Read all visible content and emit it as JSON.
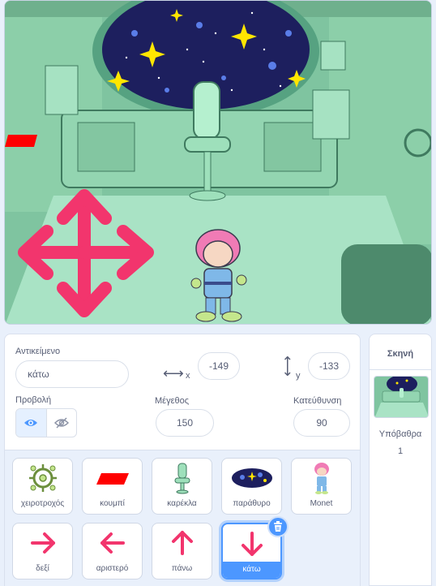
{
  "sprite_info": {
    "sprite_label": "Αντικείμενο",
    "sprite_name": "κάτω",
    "x_label": "x",
    "x_value": "-149",
    "y_label": "y",
    "y_value": "-133",
    "show_label": "Προβολή",
    "size_label": "Μέγεθος",
    "size_value": "150",
    "direction_label": "Κατεύθυνση",
    "direction_value": "90"
  },
  "sprites": [
    {
      "name": "χειροτροχός",
      "icon": "wheel-icon"
    },
    {
      "name": "κουμπί",
      "icon": "red-button-icon"
    },
    {
      "name": "καρέκλα",
      "icon": "chair-icon"
    },
    {
      "name": "παράθυρο",
      "icon": "window-icon"
    },
    {
      "name": "Monet",
      "icon": "monet-icon"
    },
    {
      "name": "δεξί",
      "icon": "arrow-right-icon"
    },
    {
      "name": "αριστερό",
      "icon": "arrow-left-icon"
    },
    {
      "name": "πάνω",
      "icon": "arrow-up-icon"
    },
    {
      "name": "κάτω",
      "icon": "arrow-down-icon",
      "selected": true
    }
  ],
  "stage_panel": {
    "title": "Σκηνή",
    "backdrops_label": "Υπόβαθρα",
    "backdrops_count": "1"
  },
  "colors": {
    "accent": "#4c97ff",
    "arrow": "#f2356d",
    "text": "#575e75"
  }
}
